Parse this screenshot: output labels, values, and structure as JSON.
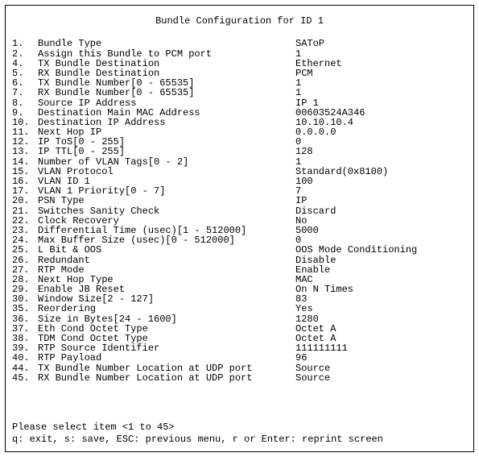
{
  "title": "Bundle Configuration for ID 1",
  "rows": [
    {
      "n": "1.",
      "label": "Bundle Type",
      "value": "SAToP"
    },
    {
      "n": "2.",
      "label": "Assign this Bundle to PCM port",
      "value": "1"
    },
    {
      "n": "4.",
      "label": "TX Bundle Destination",
      "value": "Ethernet"
    },
    {
      "n": "5.",
      "label": "RX Bundle Destination",
      "value": "PCM"
    },
    {
      "n": "6.",
      "label": "TX Bundle Number[0 - 65535]",
      "value": "1"
    },
    {
      "n": "7.",
      "label": "RX Bundle Number[0 - 65535]",
      "value": "1"
    },
    {
      "n": "8.",
      "label": "Source IP Address",
      "value": "IP 1"
    },
    {
      "n": "9.",
      "label": "Destination Main MAC Address",
      "value": "00603524A346"
    },
    {
      "n": "10.",
      "label": "Destination IP Address",
      "value": "10.10.10.4"
    },
    {
      "n": "11.",
      "label": "Next Hop IP",
      "value": "0.0.0.0"
    },
    {
      "n": "12.",
      "label": "IP ToS[0 - 255]",
      "value": "0"
    },
    {
      "n": "13.",
      "label": "IP TTL[0 - 255]",
      "value": "128"
    },
    {
      "n": "14.",
      "label": "Number of VLAN Tags[0 - 2]",
      "value": "1"
    },
    {
      "n": "15.",
      "label": "VLAN Protocol",
      "value": "Standard(0x8100)"
    },
    {
      "n": "16.",
      "label": "VLAN ID 1",
      "value": "100"
    },
    {
      "n": "17.",
      "label": "VLAN 1 Priority[0 - 7]",
      "value": "7"
    },
    {
      "n": "20.",
      "label": "PSN Type",
      "value": "IP"
    },
    {
      "n": "21.",
      "label": "Switches Sanity Check",
      "value": "Discard"
    },
    {
      "n": "22.",
      "label": "Clock Recovery",
      "value": "No"
    },
    {
      "n": "23.",
      "label": "Differential Time (usec)[1 - 512000]",
      "value": "5000"
    },
    {
      "n": "24.",
      "label": "Max Buffer Size (usec)[0 - 512000]",
      "value": "0"
    },
    {
      "n": "25.",
      "label": "L Bit & OOS",
      "value": "OOS Mode Conditioning"
    },
    {
      "n": "26.",
      "label": "Redundant",
      "value": "Disable"
    },
    {
      "n": "27.",
      "label": "RTP Mode",
      "value": "Enable"
    },
    {
      "n": "28.",
      "label": "Next Hop Type",
      "value": "MAC"
    },
    {
      "n": "29.",
      "label": "Enable JB Reset",
      "value": "On N Times"
    },
    {
      "n": "30.",
      "label": "Window Size[2 - 127]",
      "value": "83"
    },
    {
      "n": "35.",
      "label": "Reordering",
      "value": "Yes"
    },
    {
      "n": "36.",
      "label": "Size in Bytes[24 - 1600]",
      "value": "1280"
    },
    {
      "n": "37.",
      "label": "Eth Cond Octet Type",
      "value": "Octet A"
    },
    {
      "n": "38.",
      "label": "TDM Cond Octet Type",
      "value": "Octet A"
    },
    {
      "n": "39.",
      "label": "RTP Source Identifier",
      "value": "111111111"
    },
    {
      "n": "40.",
      "label": "RTP Payload",
      "value": "96"
    },
    {
      "n": "44.",
      "label": "TX Bundle Number Location at UDP port",
      "value": "Source"
    },
    {
      "n": "45.",
      "label": "RX Bundle Number Location at UDP port",
      "value": "Source"
    }
  ],
  "footer": {
    "prompt": "Please select item <1 to 45>",
    "help": "q: exit, s: save, ESC: previous menu, r or Enter: reprint screen"
  }
}
